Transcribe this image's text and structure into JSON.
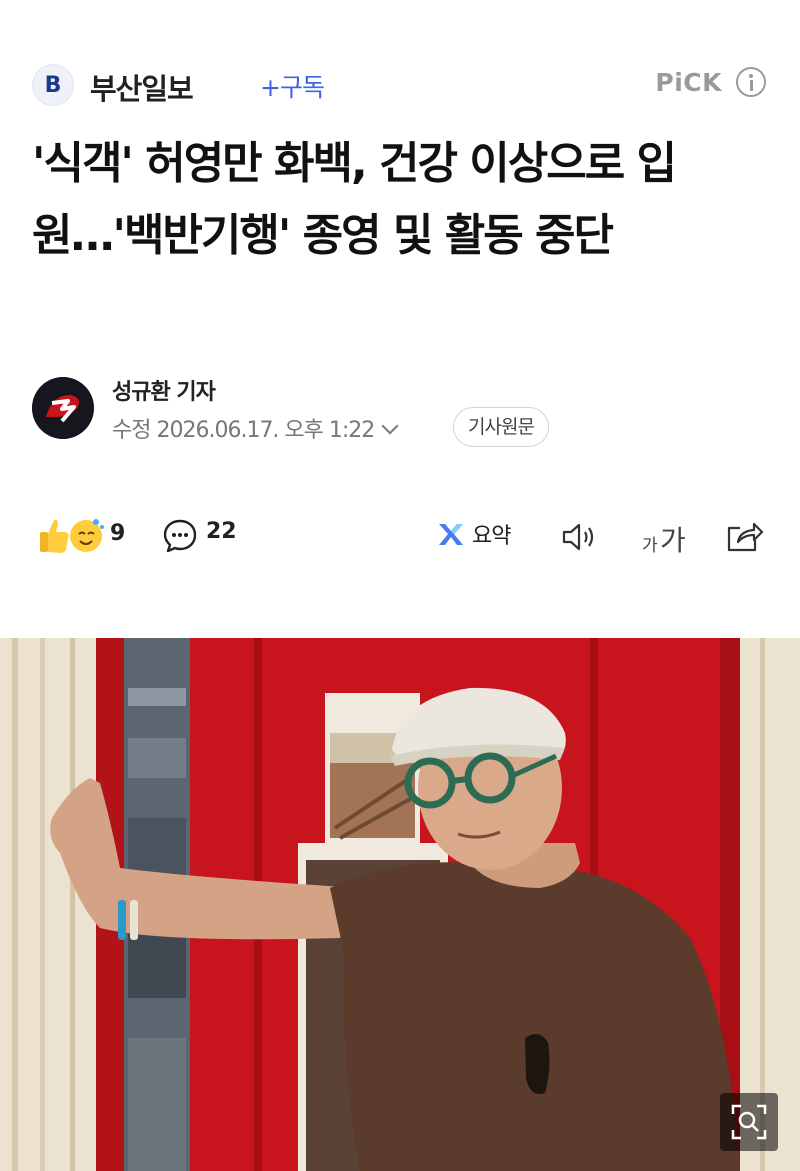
{
  "press": {
    "logo_letter": "B",
    "name": "부산일보",
    "subscribe_label": "+구독",
    "pick_label": "PiCK"
  },
  "article": {
    "headline": "'식객' 허영만 화백, 건강 이상으로 입원…'백반기행' 종영 및 활동 중단"
  },
  "author": {
    "name": "성규환 기자",
    "date_text": "수정 2026.06.17. 오후 1:22",
    "original_button": "기사원문"
  },
  "actions": {
    "reaction_count": "9",
    "comment_count": "22",
    "summary_label": "요약",
    "font_small": "가",
    "font_big": "가"
  },
  "icons": {
    "info": "info-circle-icon",
    "reaction": "thumbs-up-emoji-icon",
    "comment": "speech-bubble-icon",
    "summary": "ai-summary-icon",
    "speaker": "speaker-icon",
    "share": "share-icon",
    "zoom": "zoom-icon",
    "expand_dates": "chevron-down-icon"
  },
  "colors": {
    "accent": "#3e64e6",
    "wall_red": "#c8141c",
    "shirt_brown": "#5a3b2c"
  }
}
